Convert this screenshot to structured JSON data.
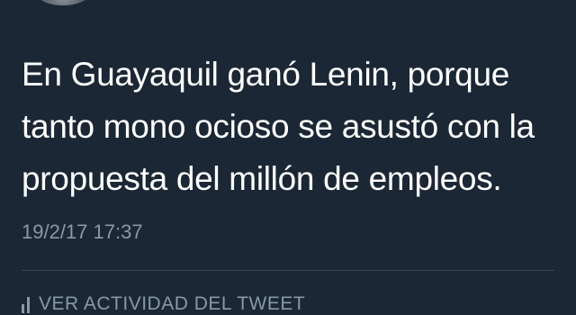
{
  "tweet": {
    "text_lines": [
      "En Guayaquil ganó Lenin, porque",
      "tanto mono ocioso se asustó con la",
      "propuesta del millón de empleos."
    ],
    "timestamp": "19/2/17 17:37"
  },
  "activity": {
    "label": "VER ACTIVIDAD DEL TWEET",
    "icon": "bar-chart-icon"
  },
  "colors": {
    "background": "#1b2734",
    "text": "#ffffff",
    "muted": "#8899a6",
    "divider": "#38444d"
  }
}
